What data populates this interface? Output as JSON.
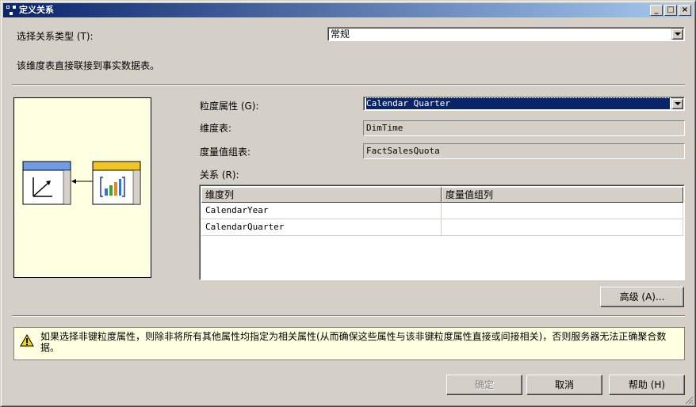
{
  "window": {
    "title": "定义关系"
  },
  "relationship_type": {
    "label": "选择关系类型 (T):",
    "value": "常规"
  },
  "description": "该维度表直接联接到事实数据表。",
  "granularity": {
    "label": "粒度属性 (G):",
    "value": "Calendar Quarter"
  },
  "dimension_table": {
    "label": "维度表:",
    "value": "DimTime"
  },
  "measure_group_table": {
    "label": "度量值组表:",
    "value": "FactSalesQuota"
  },
  "relationship": {
    "label": "关系 (R):",
    "columns": [
      "维度列",
      "度量值组列"
    ],
    "rows": [
      [
        "CalendarYear",
        ""
      ],
      [
        "CalendarQuarter",
        ""
      ]
    ]
  },
  "buttons": {
    "advanced": "高级 (A)...",
    "ok": "确定",
    "cancel": "取消",
    "help": "帮助 (H)"
  },
  "warning": "如果选择非键粒度属性，则除非将所有其他属性均指定为相关属性(从而确保这些属性与该非键粒度属性直接或间接相关)，否则服务器无法正确聚合数据。",
  "colors": {
    "title_start": "#0a246a",
    "title_end": "#a6caf0",
    "info_bg": "#ffffe1",
    "dim_header": "#6f9be8",
    "fact_header": "#f2c522"
  }
}
